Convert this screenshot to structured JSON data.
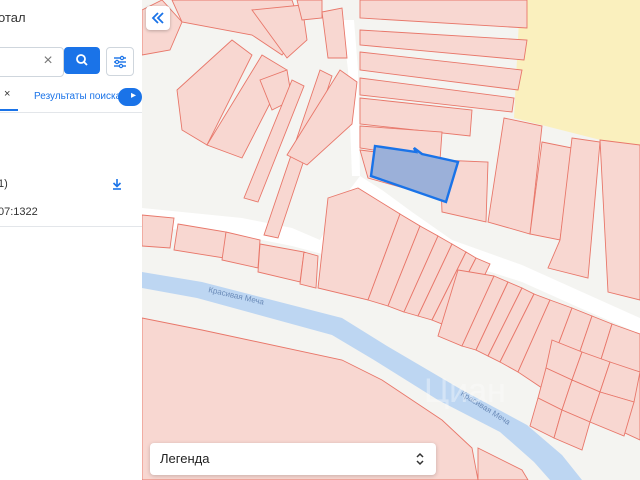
{
  "sidebar": {
    "portal_title": "отал",
    "search": {
      "value": "",
      "placeholder": ""
    },
    "chips": {
      "first_text": ")",
      "first_close": "×",
      "second_text": "Результаты поиска"
    },
    "result": {
      "title": "1)",
      "number": "07:1322"
    }
  },
  "map": {
    "street_label_1": "Красивая Меча",
    "street_label_2": "Красивая Меча",
    "watermark": "Циан",
    "colors": {
      "parcel_fill": "#f8d7d1",
      "parcel_stroke": "#e8776a",
      "road": "#ffffff",
      "river": "#bdd6f2",
      "field": "#faf0be",
      "selected_fill": "#9bb0d9",
      "selected_stroke": "#1a73e8"
    }
  },
  "legend": {
    "label": "Легенда"
  },
  "icons": {
    "clear": "close-icon",
    "search": "search-icon",
    "filter": "filter-icon",
    "download": "download-icon",
    "collapse": "double-chevron-left-icon",
    "legend_toggle": "chevron-up-down-icon"
  }
}
